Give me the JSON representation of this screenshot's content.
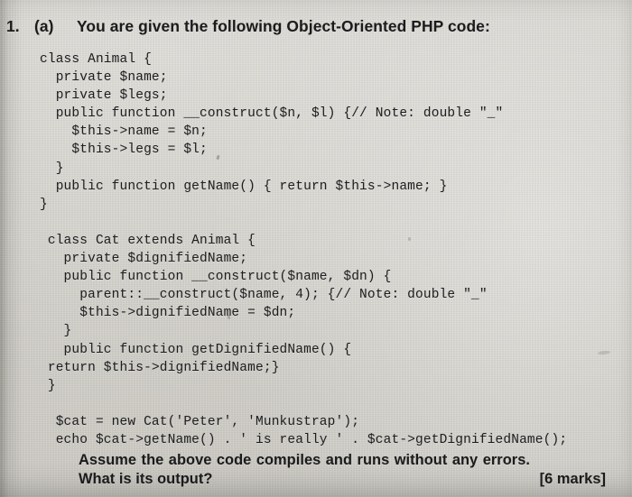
{
  "question": {
    "number": "1.",
    "part": "(a)",
    "prompt": "You are given the following Object-Oriented PHP code:"
  },
  "code": {
    "language": "PHP",
    "lines": [
      "class Animal {",
      "  private $name;",
      "  private $legs;",
      "  public function __construct($n, $l) {// Note: double \"_\"",
      "    $this->name = $n;",
      "    $this->legs = $l;",
      "  }",
      "  public function getName() { return $this->name; }",
      "}",
      "",
      " class Cat extends Animal {",
      "   private $dignifiedName;",
      "   public function __construct($name, $dn) {",
      "     parent::__construct($name, 4); {// Note: double \"_\"",
      "     $this->dignifiedName = $dn;",
      "   }",
      "   public function getDignifiedName() {",
      " return $this->dignifiedName;}",
      " }",
      "",
      "  $cat = new Cat('Peter', 'Munkustrap');",
      "  echo $cat->getName() . ' is really ' . $cat->getDignifiedName();"
    ]
  },
  "closing": {
    "assume_line": "Assume the above code compiles and runs without any errors.",
    "output_question": "What is its output?",
    "marks": "[6 marks]"
  },
  "colors": {
    "paper": "#d4d2cb",
    "ink": "#1b1b1c",
    "gutter_shadow": "#787670"
  }
}
